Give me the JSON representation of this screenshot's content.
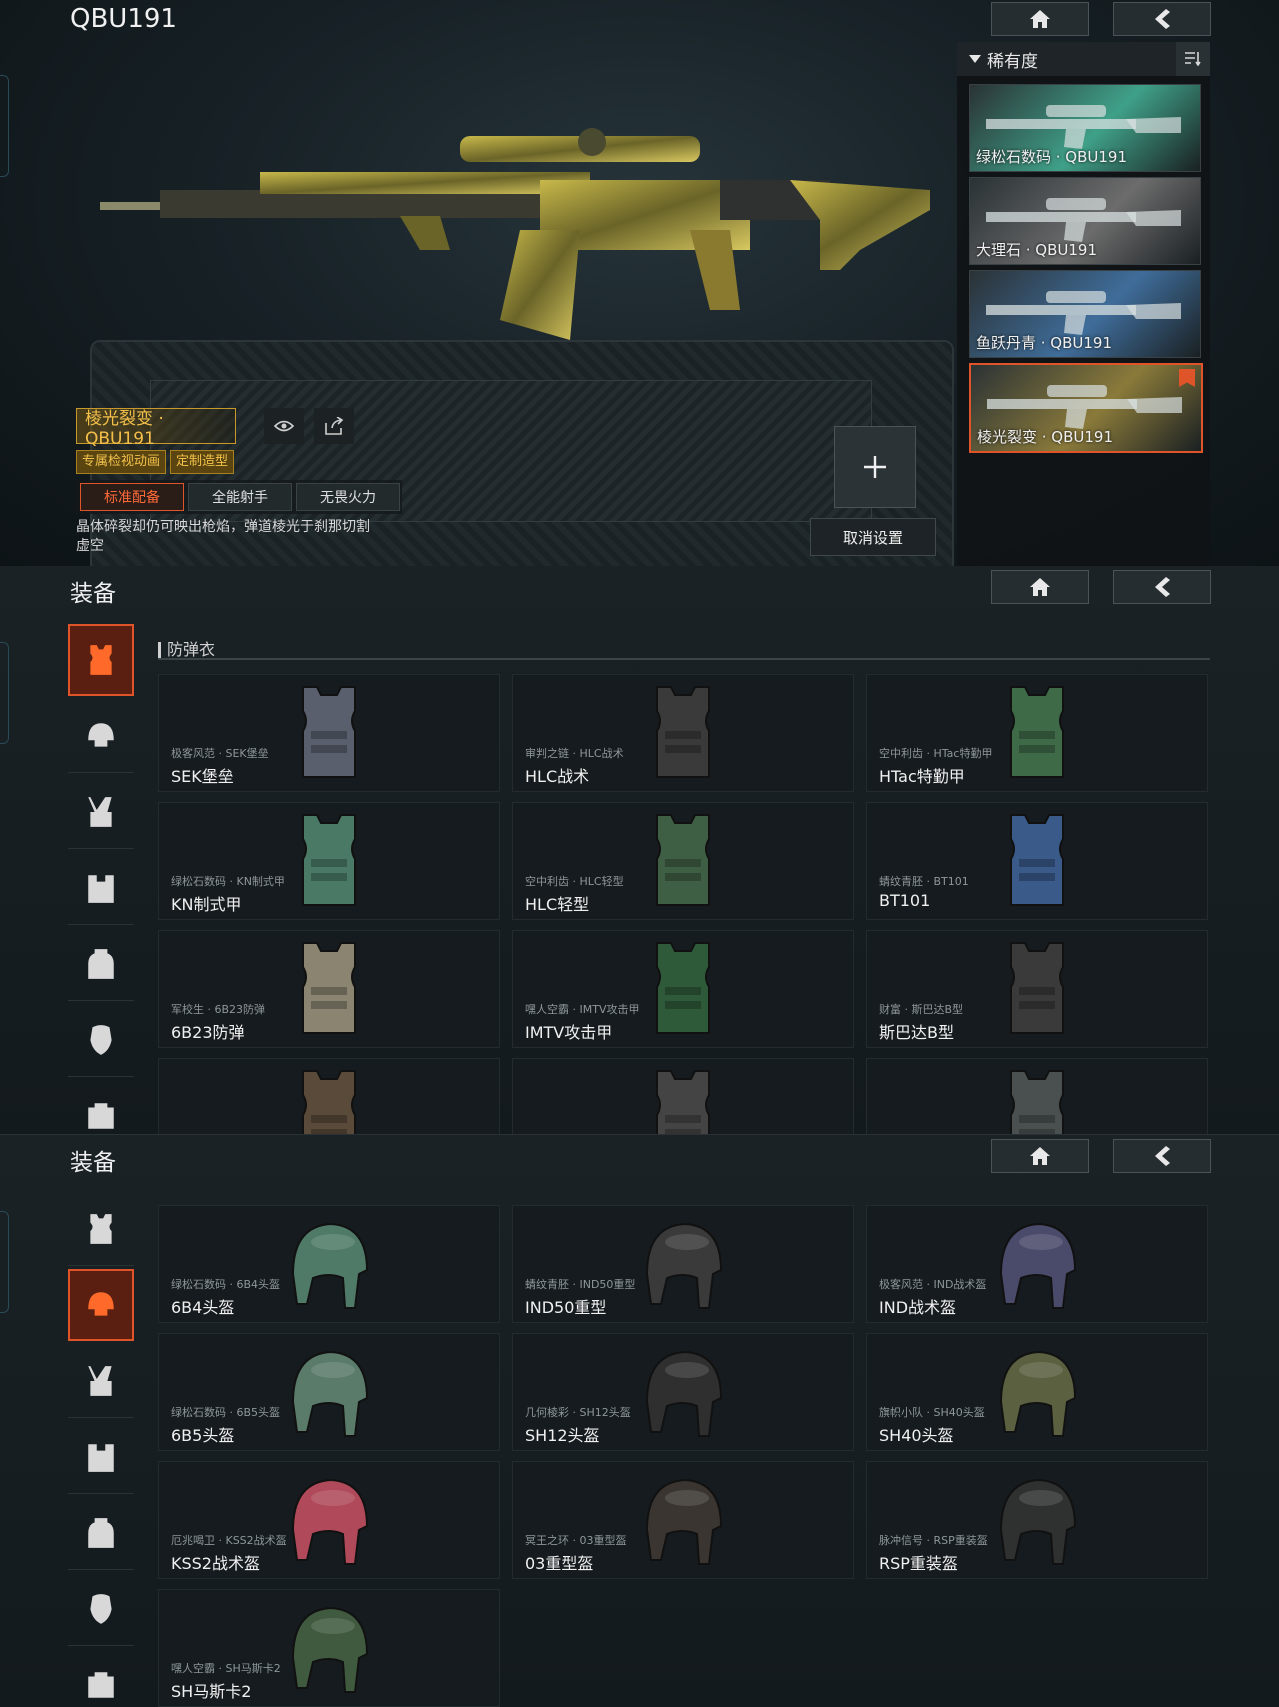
{
  "weapon_section": {
    "title": "QBU191",
    "rarity_label": "稀有度",
    "skins": [
      {
        "label": "绿松石数码 · QBU191",
        "color": "#3fa088"
      },
      {
        "label": "大理石 · QBU191",
        "color": "#6c6c6c"
      },
      {
        "label": "鱼跃丹青 · QBU191",
        "color": "#3f6d9a"
      },
      {
        "label": "棱光裂变 · QBU191",
        "color": "#8a7a3a"
      }
    ],
    "selected_weapon_name": "棱光裂变 · QBU191",
    "tags": [
      "专属检视动画",
      "定制造型"
    ],
    "loadouts": [
      "标准配备",
      "全能射手",
      "无畏火力"
    ],
    "description": "晶体碎裂却仍可映出枪焰，弹道棱光于刹那切割虚空",
    "cancel_label": "取消设置"
  },
  "armor_section": {
    "title": "装备",
    "category": "防弹衣",
    "items": [
      {
        "sub": "极客风范 · SEK堡垒",
        "name": "SEK堡垒",
        "color": "#5a5f6e"
      },
      {
        "sub": "审判之链 · HLC战术",
        "name": "HLC战术",
        "color": "#3a3a3a"
      },
      {
        "sub": "空中利齿 · HTac特勤甲",
        "name": "HTac特勤甲",
        "color": "#3f6a48"
      },
      {
        "sub": "绿松石数码 · KN制式甲",
        "name": "KN制式甲",
        "color": "#4a7a66"
      },
      {
        "sub": "空中利齿 · HLC轻型",
        "name": "HLC轻型",
        "color": "#3f5f44"
      },
      {
        "sub": "蜻纹青胚 · BT101",
        "name": "BT101",
        "color": "#3a5a8a"
      },
      {
        "sub": "军校生 · 6B23防弹",
        "name": "6B23防弹",
        "color": "#8a8470"
      },
      {
        "sub": "嘿人空霸 · IMTV攻击甲",
        "name": "IMTV攻击甲",
        "color": "#2f5a3a"
      },
      {
        "sub": "财富 · 斯巴达B型",
        "name": "斯巴达B型",
        "color": "#3a3a3a"
      },
      {
        "sub": "",
        "name": "",
        "color": "#5a4a3a"
      },
      {
        "sub": "",
        "name": "",
        "color": "#444444"
      },
      {
        "sub": "",
        "name": "",
        "color": "#4a5050"
      }
    ]
  },
  "helmet_section": {
    "title": "装备",
    "items": [
      {
        "sub": "绿松石数码 · 6B4头盔",
        "name": "6B4头盔",
        "color": "#4f7a68"
      },
      {
        "sub": "蜻纹青胚 · IND50重型",
        "name": "IND50重型",
        "color": "#3a3a3a"
      },
      {
        "sub": "极客风范 · IND战术盔",
        "name": "IND战术盔",
        "color": "#4a4a6a"
      },
      {
        "sub": "绿松石数码 · 6B5头盔",
        "name": "6B5头盔",
        "color": "#5a7a6a"
      },
      {
        "sub": "几何棱彩 · SH12头盔",
        "name": "SH12头盔",
        "color": "#2f2f2f"
      },
      {
        "sub": "旗帜小队 · SH40头盔",
        "name": "SH40头盔",
        "color": "#5a6040"
      },
      {
        "sub": "厄兆喝卫 · KSS2战术盔",
        "name": "KSS2战术盔",
        "color": "#b04a5a"
      },
      {
        "sub": "冥王之环 · 03重型盔",
        "name": "03重型盔",
        "color": "#3a3530"
      },
      {
        "sub": "脉冲信号 · RSP重装盔",
        "name": "RSP重装盔",
        "color": "#2f3030"
      },
      {
        "sub": "嘿人空霸 · SH马斯卡2",
        "name": "SH马斯卡2",
        "color": "#3f5a3f"
      }
    ]
  }
}
